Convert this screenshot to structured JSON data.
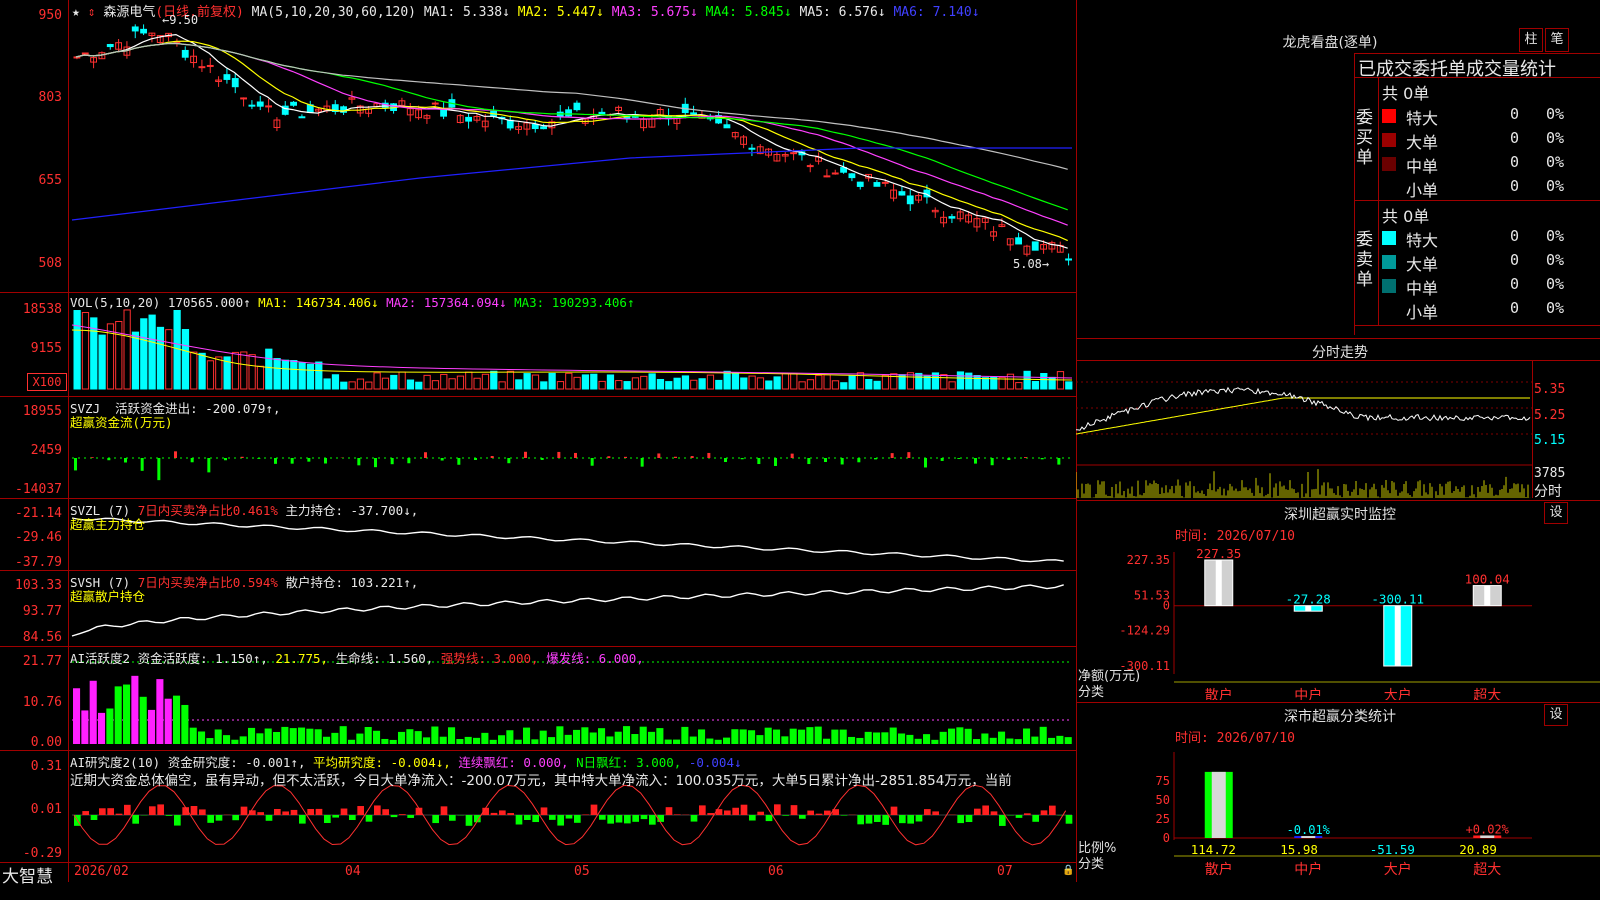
{
  "stock": {
    "name": "森源电气",
    "period": "(日线,前复权)",
    "ma_title": "MA(5,10,20,30,60,120)",
    "ma1": "MA1: 5.338↓",
    "ma2": "MA2: 5.447↓",
    "ma3": "MA3: 5.675↓",
    "ma4": "MA4: 5.845↓",
    "ma5": "MA5: 6.576↓",
    "ma6": "MA6: 7.140↓",
    "high_mark": "9.50",
    "low_mark": "5.08",
    "y_axis": [
      "950",
      "803",
      "655",
      "508"
    ]
  },
  "vol": {
    "title": "VOL(5,10,20)",
    "value": "170565.000↑",
    "ma1": "MA1: 146734.406↓",
    "ma2": "MA2: 157364.094↓",
    "ma3": "MA3: 190293.406↑",
    "y_axis": [
      "18538",
      "9155"
    ],
    "unit": "X100"
  },
  "svzj": {
    "title": "SVZJ",
    "line1": "活跃资金进出: -200.079↑,",
    "line2": "超赢资金流(万元)",
    "y_axis": [
      "18955",
      "2459",
      "-14037"
    ]
  },
  "svzl": {
    "title": "SVZL (7)",
    "desc": "7日内买卖净占比0.461%",
    "value": "主力持仓: -37.700↓,",
    "line2": "超赢主力持仓",
    "y_axis": [
      "-21.14",
      "-29.46",
      "-37.79"
    ]
  },
  "svsh": {
    "title": "SVSH (7)",
    "desc": "7日内买卖净占比0.594%",
    "value": "散户持仓: 103.221↑,",
    "line2": "超赢散户持仓",
    "y_axis": [
      "103.33",
      "93.77",
      "84.56"
    ]
  },
  "ai_active": {
    "title": "AI活跃度2",
    "v1": "资金活跃度: 1.150↑,",
    "v2": "21.775,",
    "v3": "生命线: 1.560,",
    "v4": "强势线: 3.000,",
    "v5": "爆发线: 6.000,",
    "y_axis": [
      "21.77",
      "10.76",
      "0.00"
    ]
  },
  "ai_research": {
    "title": "AI研究度2(10)",
    "v1": "资金研究度: -0.001↑,",
    "v2": "平均研究度: -0.004↓,",
    "v3": "连续飘红: 0.000,",
    "v4": "N日飘红: 3.000,",
    "v5": "-0.004↓",
    "comment": "近期大资金总体偏空，虽有异动，但不太活跃，今日大单净流入：-200.07万元，其中特大单净流入：100.035万元，大单5日累计净出-2851.854万元，当前",
    "y_axis": [
      "0.31",
      "0.01",
      "-0.29"
    ]
  },
  "x_axis": {
    "start": "2026/02",
    "m04": "04",
    "m05": "05",
    "m06": "06",
    "m07": "07"
  },
  "brand": "大智慧",
  "right": {
    "lhkp_title": "龙虎看盘(逐单)",
    "btn_zhu": "柱",
    "btn_bi": "笔",
    "table_title": "已成交委托单成交量统计",
    "buy_label": "委买单",
    "sell_label": "委卖单",
    "buy_total": "共 0单",
    "sell_total": "共 0单",
    "buy_rows": [
      {
        "label": "特大",
        "count": "0",
        "pct": "0%",
        "color": "#ff0000"
      },
      {
        "label": "大单",
        "count": "0",
        "pct": "0%",
        "color": "#9b0000"
      },
      {
        "label": "中单",
        "count": "0",
        "pct": "0%",
        "color": "#6a0000"
      },
      {
        "label": "小单",
        "count": "0",
        "pct": "0%",
        "color": "#000000"
      }
    ],
    "sell_rows": [
      {
        "label": "特大",
        "count": "0",
        "pct": "0%",
        "color": "#00ffff"
      },
      {
        "label": "大单",
        "count": "0",
        "pct": "0%",
        "color": "#009a9a"
      },
      {
        "label": "中单",
        "count": "0",
        "pct": "0%",
        "color": "#007070"
      },
      {
        "label": "小单",
        "count": "0",
        "pct": "0%",
        "color": "#000000"
      }
    ],
    "intraday_title": "分时走势",
    "intraday_y": [
      "5.35",
      "5.25",
      "5.15"
    ],
    "intraday_vol": "3785",
    "intraday_unit": "分时",
    "monitor_title": "深圳超赢实时监控",
    "monitor_btn": "设",
    "monitor_time": "时间: 2026/07/10",
    "monitor_y": [
      "227.35",
      "51.53",
      "0",
      "-124.29",
      "-300.11"
    ],
    "monitor_bars": [
      {
        "cat": "散户",
        "value": 227.35,
        "label": "227.35"
      },
      {
        "cat": "中户",
        "value": -27.28,
        "label": "-27.28"
      },
      {
        "cat": "大户",
        "value": -300.11,
        "label": "-300.11"
      },
      {
        "cat": "超大",
        "value": 100.04,
        "label": "100.04"
      }
    ],
    "monitor_ylabel": "净额(万元)",
    "monitor_xlabel": "分类",
    "class_title": "深市超赢分类统计",
    "class_btn": "设",
    "class_time": "时间: 2026/07/10",
    "class_y": [
      "75",
      "50",
      "25",
      "0"
    ],
    "class_bars": [
      {
        "cat": "散户",
        "value": 114.72,
        "label": "114.72",
        "pct": ""
      },
      {
        "cat": "中户",
        "value": 15.98,
        "label": "15.98",
        "pct": "-0.01%"
      },
      {
        "cat": "大户",
        "value": -51.59,
        "label": "-51.59",
        "pct": ""
      },
      {
        "cat": "超大",
        "value": 20.89,
        "label": "20.89",
        "pct": "+0.02%"
      }
    ],
    "class_ylabel": "比例%",
    "class_xlabel": "分类"
  },
  "chart_data": {
    "type": "bar",
    "title": "深圳超赢实时监控",
    "categories": [
      "散户",
      "中户",
      "大户",
      "超大"
    ],
    "values": [
      227.35,
      -27.28,
      -300.11,
      100.04
    ],
    "ylabel": "净额(万元)",
    "xlabel": "分类",
    "ylim": [
      -300.11,
      227.35
    ]
  }
}
